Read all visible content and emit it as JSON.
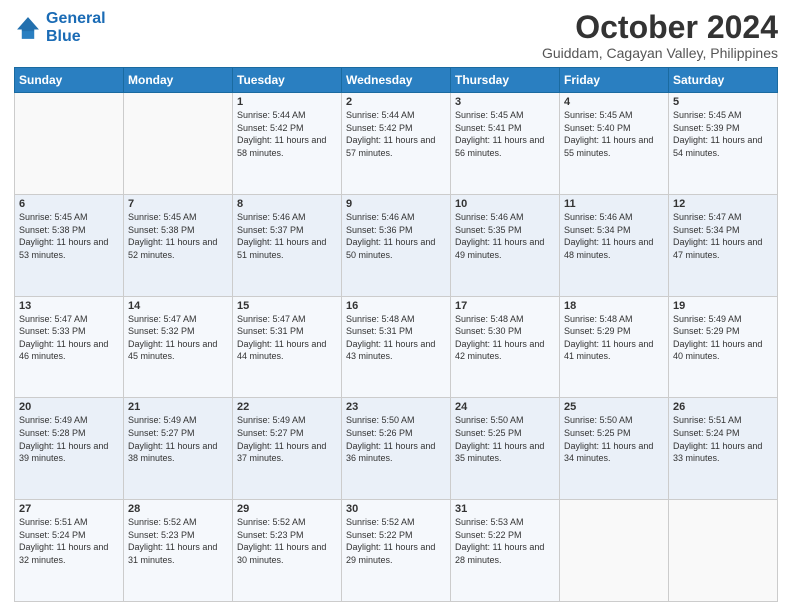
{
  "logo": {
    "line1": "General",
    "line2": "Blue"
  },
  "title": "October 2024",
  "subtitle": "Guiddam, Cagayan Valley, Philippines",
  "days_of_week": [
    "Sunday",
    "Monday",
    "Tuesday",
    "Wednesday",
    "Thursday",
    "Friday",
    "Saturday"
  ],
  "weeks": [
    [
      {
        "day": "",
        "sunrise": "",
        "sunset": "",
        "daylight": ""
      },
      {
        "day": "",
        "sunrise": "",
        "sunset": "",
        "daylight": ""
      },
      {
        "day": "1",
        "sunrise": "Sunrise: 5:44 AM",
        "sunset": "Sunset: 5:42 PM",
        "daylight": "Daylight: 11 hours and 58 minutes."
      },
      {
        "day": "2",
        "sunrise": "Sunrise: 5:44 AM",
        "sunset": "Sunset: 5:42 PM",
        "daylight": "Daylight: 11 hours and 57 minutes."
      },
      {
        "day": "3",
        "sunrise": "Sunrise: 5:45 AM",
        "sunset": "Sunset: 5:41 PM",
        "daylight": "Daylight: 11 hours and 56 minutes."
      },
      {
        "day": "4",
        "sunrise": "Sunrise: 5:45 AM",
        "sunset": "Sunset: 5:40 PM",
        "daylight": "Daylight: 11 hours and 55 minutes."
      },
      {
        "day": "5",
        "sunrise": "Sunrise: 5:45 AM",
        "sunset": "Sunset: 5:39 PM",
        "daylight": "Daylight: 11 hours and 54 minutes."
      }
    ],
    [
      {
        "day": "6",
        "sunrise": "Sunrise: 5:45 AM",
        "sunset": "Sunset: 5:38 PM",
        "daylight": "Daylight: 11 hours and 53 minutes."
      },
      {
        "day": "7",
        "sunrise": "Sunrise: 5:45 AM",
        "sunset": "Sunset: 5:38 PM",
        "daylight": "Daylight: 11 hours and 52 minutes."
      },
      {
        "day": "8",
        "sunrise": "Sunrise: 5:46 AM",
        "sunset": "Sunset: 5:37 PM",
        "daylight": "Daylight: 11 hours and 51 minutes."
      },
      {
        "day": "9",
        "sunrise": "Sunrise: 5:46 AM",
        "sunset": "Sunset: 5:36 PM",
        "daylight": "Daylight: 11 hours and 50 minutes."
      },
      {
        "day": "10",
        "sunrise": "Sunrise: 5:46 AM",
        "sunset": "Sunset: 5:35 PM",
        "daylight": "Daylight: 11 hours and 49 minutes."
      },
      {
        "day": "11",
        "sunrise": "Sunrise: 5:46 AM",
        "sunset": "Sunset: 5:34 PM",
        "daylight": "Daylight: 11 hours and 48 minutes."
      },
      {
        "day": "12",
        "sunrise": "Sunrise: 5:47 AM",
        "sunset": "Sunset: 5:34 PM",
        "daylight": "Daylight: 11 hours and 47 minutes."
      }
    ],
    [
      {
        "day": "13",
        "sunrise": "Sunrise: 5:47 AM",
        "sunset": "Sunset: 5:33 PM",
        "daylight": "Daylight: 11 hours and 46 minutes."
      },
      {
        "day": "14",
        "sunrise": "Sunrise: 5:47 AM",
        "sunset": "Sunset: 5:32 PM",
        "daylight": "Daylight: 11 hours and 45 minutes."
      },
      {
        "day": "15",
        "sunrise": "Sunrise: 5:47 AM",
        "sunset": "Sunset: 5:31 PM",
        "daylight": "Daylight: 11 hours and 44 minutes."
      },
      {
        "day": "16",
        "sunrise": "Sunrise: 5:48 AM",
        "sunset": "Sunset: 5:31 PM",
        "daylight": "Daylight: 11 hours and 43 minutes."
      },
      {
        "day": "17",
        "sunrise": "Sunrise: 5:48 AM",
        "sunset": "Sunset: 5:30 PM",
        "daylight": "Daylight: 11 hours and 42 minutes."
      },
      {
        "day": "18",
        "sunrise": "Sunrise: 5:48 AM",
        "sunset": "Sunset: 5:29 PM",
        "daylight": "Daylight: 11 hours and 41 minutes."
      },
      {
        "day": "19",
        "sunrise": "Sunrise: 5:49 AM",
        "sunset": "Sunset: 5:29 PM",
        "daylight": "Daylight: 11 hours and 40 minutes."
      }
    ],
    [
      {
        "day": "20",
        "sunrise": "Sunrise: 5:49 AM",
        "sunset": "Sunset: 5:28 PM",
        "daylight": "Daylight: 11 hours and 39 minutes."
      },
      {
        "day": "21",
        "sunrise": "Sunrise: 5:49 AM",
        "sunset": "Sunset: 5:27 PM",
        "daylight": "Daylight: 11 hours and 38 minutes."
      },
      {
        "day": "22",
        "sunrise": "Sunrise: 5:49 AM",
        "sunset": "Sunset: 5:27 PM",
        "daylight": "Daylight: 11 hours and 37 minutes."
      },
      {
        "day": "23",
        "sunrise": "Sunrise: 5:50 AM",
        "sunset": "Sunset: 5:26 PM",
        "daylight": "Daylight: 11 hours and 36 minutes."
      },
      {
        "day": "24",
        "sunrise": "Sunrise: 5:50 AM",
        "sunset": "Sunset: 5:25 PM",
        "daylight": "Daylight: 11 hours and 35 minutes."
      },
      {
        "day": "25",
        "sunrise": "Sunrise: 5:50 AM",
        "sunset": "Sunset: 5:25 PM",
        "daylight": "Daylight: 11 hours and 34 minutes."
      },
      {
        "day": "26",
        "sunrise": "Sunrise: 5:51 AM",
        "sunset": "Sunset: 5:24 PM",
        "daylight": "Daylight: 11 hours and 33 minutes."
      }
    ],
    [
      {
        "day": "27",
        "sunrise": "Sunrise: 5:51 AM",
        "sunset": "Sunset: 5:24 PM",
        "daylight": "Daylight: 11 hours and 32 minutes."
      },
      {
        "day": "28",
        "sunrise": "Sunrise: 5:52 AM",
        "sunset": "Sunset: 5:23 PM",
        "daylight": "Daylight: 11 hours and 31 minutes."
      },
      {
        "day": "29",
        "sunrise": "Sunrise: 5:52 AM",
        "sunset": "Sunset: 5:23 PM",
        "daylight": "Daylight: 11 hours and 30 minutes."
      },
      {
        "day": "30",
        "sunrise": "Sunrise: 5:52 AM",
        "sunset": "Sunset: 5:22 PM",
        "daylight": "Daylight: 11 hours and 29 minutes."
      },
      {
        "day": "31",
        "sunrise": "Sunrise: 5:53 AM",
        "sunset": "Sunset: 5:22 PM",
        "daylight": "Daylight: 11 hours and 28 minutes."
      },
      {
        "day": "",
        "sunrise": "",
        "sunset": "",
        "daylight": ""
      },
      {
        "day": "",
        "sunrise": "",
        "sunset": "",
        "daylight": ""
      }
    ]
  ]
}
